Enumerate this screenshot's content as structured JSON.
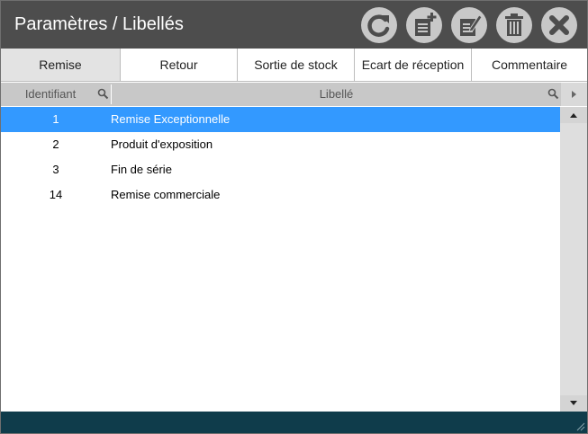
{
  "window": {
    "title": "Paramètres / Libellés"
  },
  "toolbar": [
    {
      "name": "refresh-button",
      "icon": "refresh-icon"
    },
    {
      "name": "add-button",
      "icon": "add-document-icon"
    },
    {
      "name": "edit-button",
      "icon": "edit-document-icon"
    },
    {
      "name": "delete-button",
      "icon": "trash-icon"
    },
    {
      "name": "close-button",
      "icon": "close-icon"
    }
  ],
  "tabs": [
    {
      "label": "Remise",
      "active": true
    },
    {
      "label": "Retour",
      "active": false
    },
    {
      "label": "Sortie de stock",
      "active": false
    },
    {
      "label": "Ecart de réception",
      "active": false
    },
    {
      "label": "Commentaire",
      "active": false
    }
  ],
  "grid": {
    "columns": [
      "Identifiant",
      "Libellé"
    ],
    "rows": [
      {
        "id": "1",
        "label": "Remise Exceptionnelle",
        "selected": true
      },
      {
        "id": "2",
        "label": "Produit d'exposition",
        "selected": false
      },
      {
        "id": "3",
        "label": "Fin de série",
        "selected": false
      },
      {
        "id": "14",
        "label": "Remise commerciale",
        "selected": false
      }
    ]
  },
  "colors": {
    "titlebar": "#4d4d4d",
    "selection": "#3399ff",
    "footer": "#0f3c4b",
    "toolbar_button": "#c8c8c8",
    "icon": "#4d4d4d"
  }
}
